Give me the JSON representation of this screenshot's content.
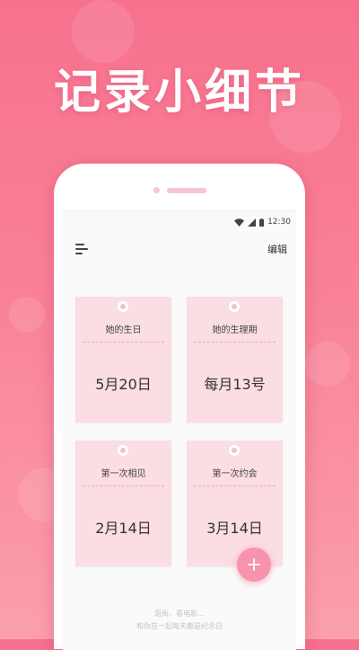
{
  "promo": {
    "headline": "记录小细节"
  },
  "status_bar": {
    "time": "12:30"
  },
  "toolbar": {
    "edit_label": "编辑"
  },
  "cards": [
    {
      "title": "她的生日",
      "date": "5月20日"
    },
    {
      "title": "她的生理期",
      "date": "每月13号"
    },
    {
      "title": "第一次相见",
      "date": "2月14日"
    },
    {
      "title": "第一次约会",
      "date": "3月14日"
    }
  ],
  "footer": {
    "line1": "逛街、看电影...",
    "line2": "和你在一起每天都是纪念日"
  },
  "colors": {
    "accent": "#f893ad",
    "card": "#fbdde4",
    "background": "#f7718e"
  }
}
